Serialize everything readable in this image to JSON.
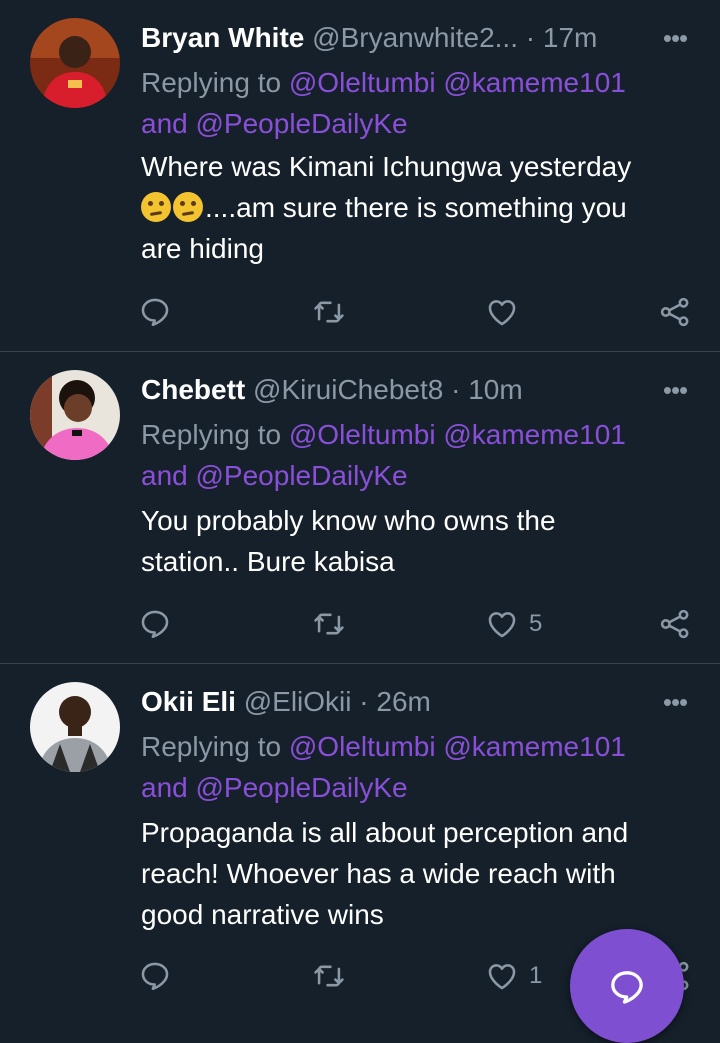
{
  "colors": {
    "background": "#15202b",
    "link": "#8a4fd8",
    "muted": "#8b98a5",
    "fab": "#7e4fd1",
    "divider": "#38444d"
  },
  "tweets": [
    {
      "name": "Bryan White",
      "handle": "@Bryanwhite2...",
      "time": "· 17m",
      "replying_prefix": "Replying to",
      "mention1": "@Oleltumbi",
      "mention2": "@kameme101",
      "and": "and",
      "mention3": "@PeopleDailyKe",
      "text_line1": "Where was Kimani Ichungwa yesterday",
      "text_line2": "....am sure there is something you",
      "text_line3": "are hiding",
      "like_count": ""
    },
    {
      "name": "Chebett",
      "handle": "@KiruiChebet8",
      "time": "· 10m",
      "replying_prefix": "Replying to",
      "mention1": "@Oleltumbi",
      "mention2": "@kameme101",
      "and": "and",
      "mention3": "@PeopleDailyKe",
      "text_line1": "You probably know who owns the",
      "text_line2": "station.. Bure kabisa",
      "like_count": "5"
    },
    {
      "name": "Okii Eli",
      "handle": "@EliOkii",
      "time": "· 26m",
      "replying_prefix": "Replying to",
      "mention1": "@Oleltumbi",
      "mention2": "@kameme101",
      "and": "and",
      "mention3": "@PeopleDailyKe",
      "text_line1": "Propaganda is all about perception and",
      "text_line2": "reach! Whoever has a wide reach with",
      "text_line3": "good narrative wins",
      "like_count": "1"
    }
  ],
  "icons": [
    "comment-icon",
    "retweet-icon",
    "like-icon",
    "share-icon",
    "more-icon",
    "compose-icon"
  ]
}
